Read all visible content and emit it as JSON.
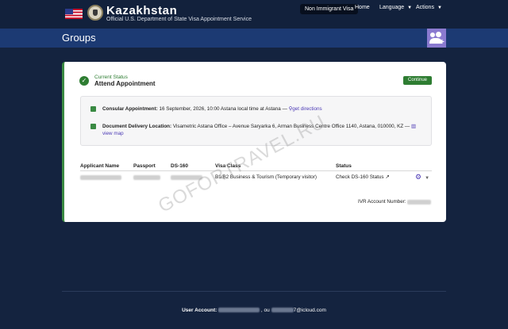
{
  "header": {
    "title": "Kazakhstan",
    "subtitle": "Official U.S. Department of State Visa Appointment Service",
    "nav": {
      "non_immigrant": "Non Immigrant Visa",
      "home": "Home",
      "language": "Language",
      "actions": "Actions"
    }
  },
  "band": {
    "title": "Groups"
  },
  "status": {
    "label": "Current Status",
    "value": "Attend Appointment",
    "continue_label": "Continue"
  },
  "appointment": {
    "consular_label": "Consular Appointment:",
    "consular_value": "16 September, 2026, 10:00 Astana local time at Astana —",
    "directions_link": "get directions",
    "delivery_label": "Document Delivery Location:",
    "delivery_value": "Visametric Astana Office – Avenue Saryarka 6, Arman Business Centre Office 1140, Astana, 010000, KZ —",
    "view_map": "view map"
  },
  "table": {
    "headers": [
      "Applicant Name",
      "Passport",
      "DS-160",
      "Visa Class",
      "Status"
    ],
    "row": {
      "visa_class": "B1/B2 Business & Tourism (Temporary visitor)",
      "status_link": "Check DS-160 Status"
    }
  },
  "ivr": {
    "label": "IVR Account Number:"
  },
  "footer": {
    "user_account": "User Account:",
    "separator": ", ou",
    "email_suffix": "7@icloud.com"
  },
  "watermark": "GOFORTRAVEL.RU",
  "colors": {
    "accent_green": "#2e7d32",
    "link_purple": "#4b39b5",
    "band_blue": "#1c3a73",
    "nav_dark": "#12213c"
  }
}
